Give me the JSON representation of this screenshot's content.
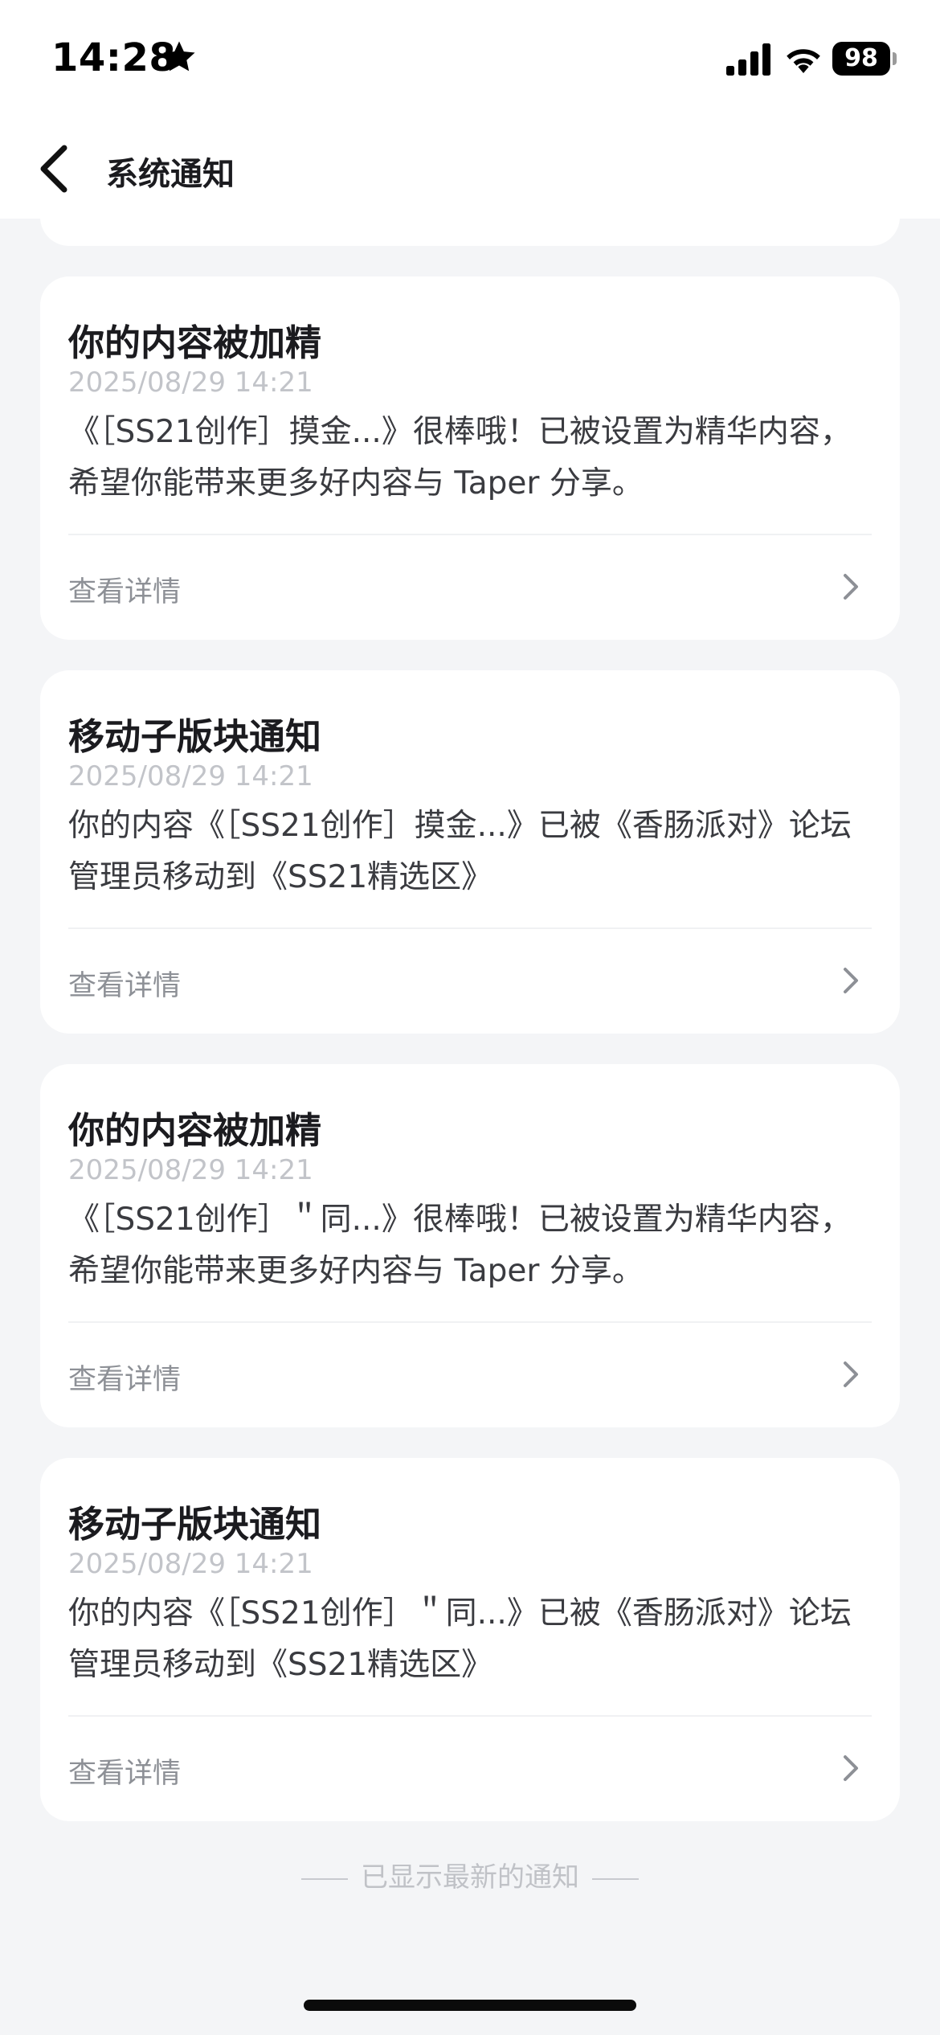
{
  "status_bar": {
    "time": "14:28",
    "battery": "98"
  },
  "nav": {
    "title": "系统通知"
  },
  "notifications": [
    {
      "title": "你的内容被加精",
      "time": "2025/08/29 14:21",
      "body": "《［SS21创作］摸金...》很棒哦！已被设置为精华内容，希望你能带来更多好内容与 Taper 分享。",
      "action": "查看详情"
    },
    {
      "title": "移动子版块通知",
      "time": "2025/08/29 14:21",
      "body": "你的内容《［SS21创作］摸金...》已被《香肠派对》论坛管理员移动到《SS21精选区》",
      "action": "查看详情"
    },
    {
      "title": "你的内容被加精",
      "time": "2025/08/29 14:21",
      "body": "《［SS21创作］＂同...》很棒哦！已被设置为精华内容，希望你能带来更多好内容与 Taper 分享。",
      "action": "查看详情"
    },
    {
      "title": "移动子版块通知",
      "time": "2025/08/29 14:21",
      "body": "你的内容《［SS21创作］＂同...》已被《香肠派对》论坛管理员移动到《SS21精选区》",
      "action": "查看详情"
    }
  ],
  "footer": {
    "end_text": "已显示最新的通知"
  },
  "icons": {
    "star": "star-icon",
    "signal": "cellular-signal-icon",
    "wifi": "wifi-icon",
    "battery": "battery-icon",
    "back": "chevron-left-icon",
    "detail": "chevron-right-icon"
  },
  "colors": {
    "background": "#f4f5f7",
    "card": "#ffffff",
    "title_text": "#1b1b1f",
    "timestamp_text": "#c2c4c9",
    "link_text": "#8d9096"
  }
}
